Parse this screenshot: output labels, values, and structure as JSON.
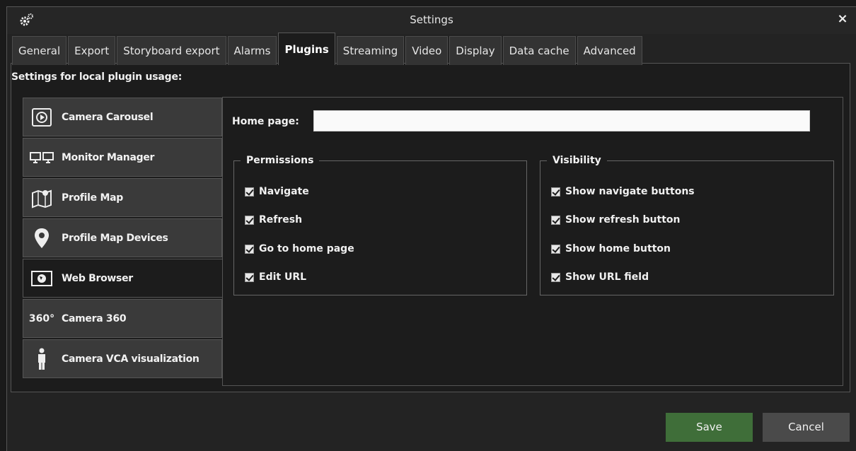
{
  "window": {
    "title": "Settings",
    "close_label": "×"
  },
  "tabs": [
    {
      "label": "General"
    },
    {
      "label": "Export"
    },
    {
      "label": "Storyboard export"
    },
    {
      "label": "Alarms"
    },
    {
      "label": "Plugins",
      "active": true
    },
    {
      "label": "Streaming"
    },
    {
      "label": "Video"
    },
    {
      "label": "Display"
    },
    {
      "label": "Data cache"
    },
    {
      "label": "Advanced"
    }
  ],
  "panel": {
    "heading": "Settings for local plugin usage:"
  },
  "plugins": [
    {
      "label": "Camera Carousel",
      "icon": "carousel-icon"
    },
    {
      "label": "Monitor Manager",
      "icon": "monitors-icon"
    },
    {
      "label": "Profile Map",
      "icon": "map-icon"
    },
    {
      "label": "Profile Map Devices",
      "icon": "map-pin-icon"
    },
    {
      "label": "Web Browser",
      "icon": "globe-icon",
      "active": true
    },
    {
      "label": "Camera 360",
      "icon": "camera-360-icon",
      "icon_text": "360°"
    },
    {
      "label": "Camera VCA visualization",
      "icon": "person-icon"
    }
  ],
  "web_browser": {
    "home_page_label": "Home page:",
    "home_page_value": "",
    "permissions": {
      "legend": "Permissions",
      "items": [
        {
          "label": "Navigate",
          "checked": true
        },
        {
          "label": "Refresh",
          "checked": true
        },
        {
          "label": "Go to home page",
          "checked": true
        },
        {
          "label": "Edit URL",
          "checked": true
        }
      ]
    },
    "visibility": {
      "legend": "Visibility",
      "items": [
        {
          "label": "Show navigate buttons",
          "checked": true
        },
        {
          "label": "Show refresh button",
          "checked": true
        },
        {
          "label": "Show home button",
          "checked": true
        },
        {
          "label": "Show URL field",
          "checked": true
        }
      ]
    }
  },
  "buttons": {
    "save": "Save",
    "cancel": "Cancel"
  },
  "colors": {
    "save_button": "#3f6e39",
    "cancel_button": "#4a4a4a",
    "background": "#1c1c1c",
    "accent_border": "#555555"
  }
}
